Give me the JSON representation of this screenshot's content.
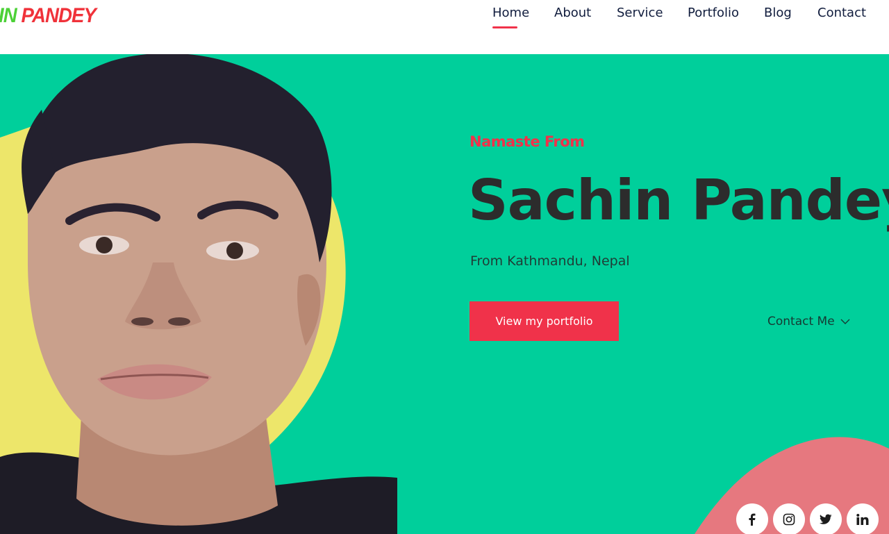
{
  "header": {
    "logo_part1": "IN",
    "logo_part2": " PANDEY",
    "nav": [
      {
        "label": "Home",
        "active": true
      },
      {
        "label": "About"
      },
      {
        "label": "Service"
      },
      {
        "label": "Portfolio"
      },
      {
        "label": "Blog"
      },
      {
        "label": "Contact"
      }
    ]
  },
  "hero": {
    "greeting": "Namaste From",
    "name": "Sachin Pandey",
    "location": "From Kathmandu, Nepal",
    "primary_button": "View my portfolio",
    "contact_link": "Contact Me",
    "contact_icon": "chevron-down-icon"
  },
  "social": [
    {
      "name": "facebook",
      "icon": "facebook-icon"
    },
    {
      "name": "instagram",
      "icon": "instagram-icon"
    },
    {
      "name": "twitter",
      "icon": "twitter-icon"
    },
    {
      "name": "linkedin",
      "icon": "linkedin-icon"
    }
  ],
  "colors": {
    "hero_bg": "#00cf9b",
    "accent": "#f0324a",
    "yellow_shape": "#ede66a",
    "pink_shape": "#e6787f",
    "nav_text": "#101c3d",
    "title_text": "#2c2c2c"
  }
}
